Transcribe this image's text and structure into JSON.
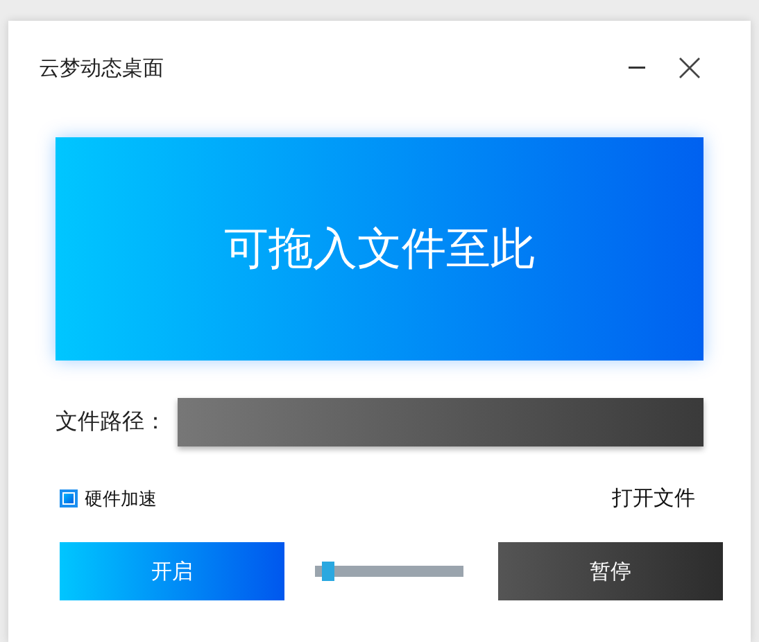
{
  "window": {
    "title": "云梦动态桌面"
  },
  "drop_zone": {
    "text": "可拖入文件至此"
  },
  "file_path": {
    "label": "文件路径："
  },
  "hardware_acceleration": {
    "label": "硬件加速",
    "checked": true
  },
  "open_file": {
    "label": "打开文件"
  },
  "start_button": {
    "label": "开启"
  },
  "volume_slider": {
    "level": 0.05
  },
  "pause_button": {
    "label": "暂停"
  }
}
